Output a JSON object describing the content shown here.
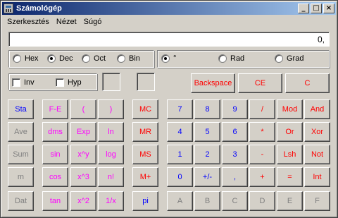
{
  "window": {
    "title": "Számológép"
  },
  "titlebar": {
    "minimize": "_",
    "maximize": "□",
    "close": "×"
  },
  "menu": [
    "Szerkesztés",
    "Nézet",
    "Súgó"
  ],
  "display": {
    "value": "0,"
  },
  "base_radios": [
    {
      "label": "Hex",
      "selected": false
    },
    {
      "label": "Dec",
      "selected": true
    },
    {
      "label": "Oct",
      "selected": false
    },
    {
      "label": "Bin",
      "selected": false
    }
  ],
  "angle_radios": [
    {
      "label": "°",
      "selected": true
    },
    {
      "label": "Rad",
      "selected": false
    },
    {
      "label": "Grad",
      "selected": false
    }
  ],
  "checks": [
    {
      "label": "Inv",
      "checked": false
    },
    {
      "label": "Hyp",
      "checked": false
    }
  ],
  "edit_buttons": [
    "Backspace",
    "CE",
    "C"
  ],
  "stat_buttons": [
    "Sta",
    "Ave",
    "Sum",
    "m",
    "Dat"
  ],
  "fn_buttons": [
    [
      "F-E",
      "(",
      ")"
    ],
    [
      "dms",
      "Exp",
      "ln"
    ],
    [
      "sin",
      "x^y",
      "log"
    ],
    [
      "cos",
      "x^3",
      "n!"
    ],
    [
      "tan",
      "x^2",
      "1/x"
    ]
  ],
  "mem_buttons": [
    "MC",
    "MR",
    "MS",
    "M+",
    "pi"
  ],
  "key_rows": [
    [
      "7",
      "8",
      "9",
      "/",
      "Mod",
      "And"
    ],
    [
      "4",
      "5",
      "6",
      "*",
      "Or",
      "Xor"
    ],
    [
      "1",
      "2",
      "3",
      "-",
      "Lsh",
      "Not"
    ],
    [
      "0",
      "+/-",
      ",",
      "+",
      "=",
      "Int"
    ],
    [
      "A",
      "B",
      "C",
      "D",
      "E",
      "F"
    ]
  ],
  "colors": {
    "blue": "#0000ff",
    "red": "#ff0000",
    "magenta": "#ff00ff",
    "gray": "#808080",
    "dark_blue": "#000080",
    "face": "#d4d0c8"
  }
}
